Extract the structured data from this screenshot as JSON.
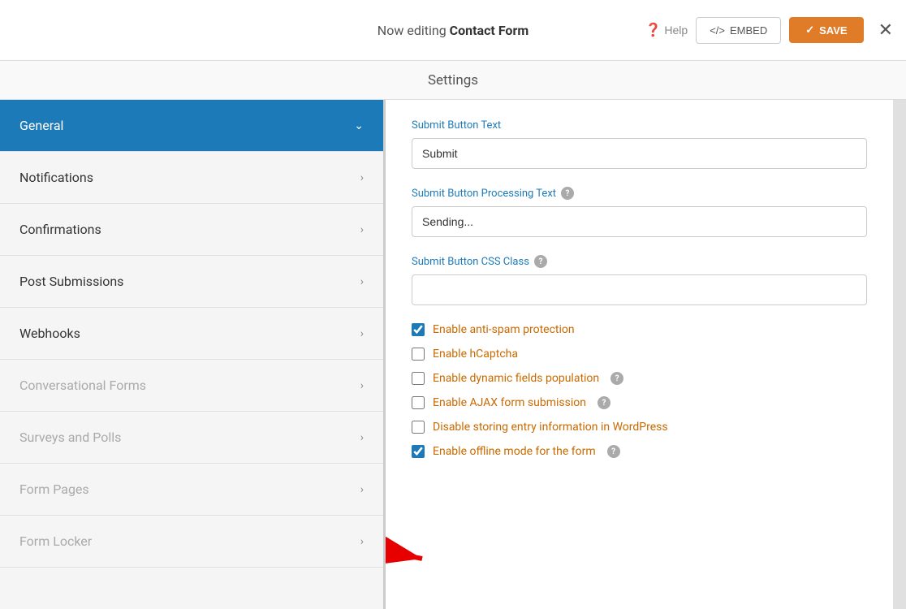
{
  "header": {
    "editing_prefix": "Now editing ",
    "form_name": "Contact Form",
    "help_label": "Help",
    "embed_label": "EMBED",
    "save_label": "SAVE",
    "close_label": "✕"
  },
  "settings_bar": {
    "title": "Settings"
  },
  "sidebar": {
    "items": [
      {
        "id": "general",
        "label": "General",
        "active": true,
        "disabled": false
      },
      {
        "id": "notifications",
        "label": "Notifications",
        "active": false,
        "disabled": false
      },
      {
        "id": "confirmations",
        "label": "Confirmations",
        "active": false,
        "disabled": false
      },
      {
        "id": "post-submissions",
        "label": "Post Submissions",
        "active": false,
        "disabled": false
      },
      {
        "id": "webhooks",
        "label": "Webhooks",
        "active": false,
        "disabled": false
      },
      {
        "id": "conversational-forms",
        "label": "Conversational Forms",
        "active": false,
        "disabled": true
      },
      {
        "id": "surveys-polls",
        "label": "Surveys and Polls",
        "active": false,
        "disabled": true
      },
      {
        "id": "form-pages",
        "label": "Form Pages",
        "active": false,
        "disabled": true
      },
      {
        "id": "form-locker",
        "label": "Form Locker",
        "active": false,
        "disabled": true
      }
    ]
  },
  "content": {
    "submit_button_text_label": "Submit Button Text",
    "submit_button_text_value": "Submit",
    "submit_button_processing_label": "Submit Button Processing Text",
    "submit_button_processing_value": "Sending...",
    "submit_button_css_label": "Submit Button CSS Class",
    "submit_button_css_value": "",
    "checkboxes": [
      {
        "id": "antispam",
        "label": "Enable anti-spam protection",
        "checked": true,
        "has_help": false
      },
      {
        "id": "hcaptcha",
        "label": "Enable hCaptcha",
        "checked": false,
        "has_help": false
      },
      {
        "id": "dynamic-fields",
        "label": "Enable dynamic fields population",
        "checked": false,
        "has_help": true
      },
      {
        "id": "ajax-submit",
        "label": "Enable AJAX form submission",
        "checked": false,
        "has_help": true
      },
      {
        "id": "disable-storing",
        "label": "Disable storing entry information in WordPress",
        "checked": false,
        "has_help": false
      },
      {
        "id": "offline-mode",
        "label": "Enable offline mode for the form",
        "checked": true,
        "has_help": true
      }
    ]
  }
}
